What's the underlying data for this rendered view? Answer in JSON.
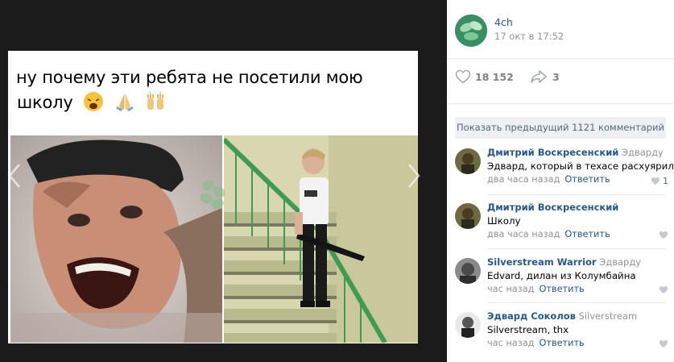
{
  "meme": {
    "caption_line1": "ну почему эти ребята не посетили мою",
    "caption_line2": "школу",
    "caption_emoji": [
      "weary-face-emoji",
      "folded-hands-emoji",
      "raising-hands-emoji"
    ]
  },
  "post": {
    "author": "4ch",
    "date": "17 окт в 17:52",
    "likes": "18 152",
    "shares": "3"
  },
  "comments_section": {
    "show_previous_label": "Показать предыдущий 1121 комментарий",
    "items": [
      {
        "author": "Дмитрий Воскресенский",
        "reply_to": "Эдварду",
        "text": "Эдвард, который в техасе расхуярил",
        "time": "два часа назад",
        "reply_label": "Ответить",
        "likes": "1"
      },
      {
        "author": "Дмитрий Воскресенский",
        "reply_to": "",
        "text": "Школу",
        "time": "два часа назад",
        "reply_label": "Ответить",
        "likes": ""
      },
      {
        "author": "Silverstream Warrior",
        "reply_to": "Эдварду",
        "text": "Edvard, дилан из Колумбайна",
        "time": "час назад",
        "reply_label": "Ответить",
        "likes": ""
      },
      {
        "author": "Эдвард Соколов",
        "reply_to": "Silverstream",
        "text": "Silverstream, thx",
        "time": "час назад",
        "reply_label": "Ответить",
        "likes": ""
      }
    ]
  },
  "colors": {
    "viewer_bg": "#1b1b1c",
    "link": "#2a5885",
    "muted": "#939393",
    "like_heart": "#c5c9cf"
  }
}
